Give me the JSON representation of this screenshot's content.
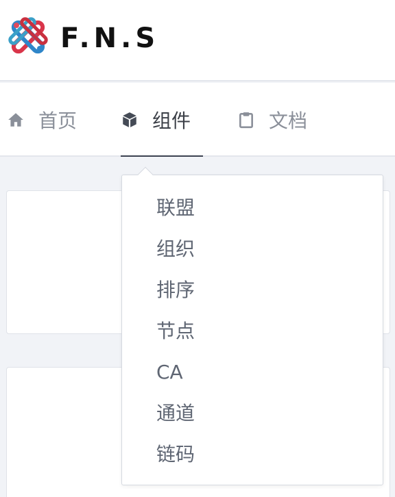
{
  "brand": {
    "name": "F.N.S"
  },
  "nav": {
    "items": [
      {
        "label": "首页",
        "icon": "home-icon"
      },
      {
        "label": "组件",
        "icon": "cube-icon",
        "active": true
      },
      {
        "label": "文档",
        "icon": "clipboard-icon"
      }
    ]
  },
  "dropdown": {
    "items": [
      "联盟",
      "组织",
      "排序",
      "节点",
      "CA",
      "通道",
      "链码"
    ]
  },
  "colors": {
    "nav_text": "#8a8f99",
    "nav_active": "#3b3f47",
    "menu_text": "#5f6673",
    "background": "#f1f3f7"
  }
}
